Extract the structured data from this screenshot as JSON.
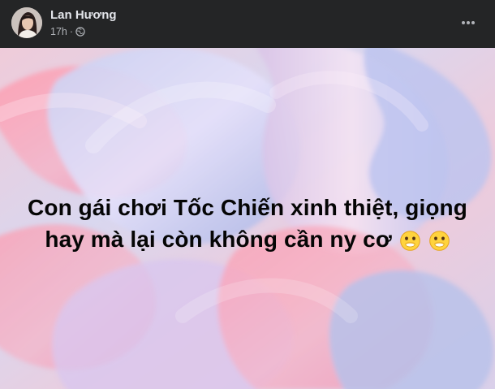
{
  "post": {
    "author_name": "Lan Hương",
    "timestamp": "17h",
    "separator": "·",
    "privacy_icon": "globe-icon",
    "menu_icon": "more-options-icon",
    "text": "Con gái chơi Tốc Chiến xinh thiệt, giọng hay mà lại còn không cần ny cơ",
    "emojis": [
      "face-with-hand-over-mouth-emoji",
      "face-with-hand-over-mouth-emoji"
    ]
  },
  "colors": {
    "header_background": "#242526",
    "primary_text": "#e4e6eb",
    "secondary_text": "#b0b3b8",
    "post_text": "#050505",
    "background_pink": "#f0a4b5",
    "background_lavender": "#c9c8ef"
  }
}
